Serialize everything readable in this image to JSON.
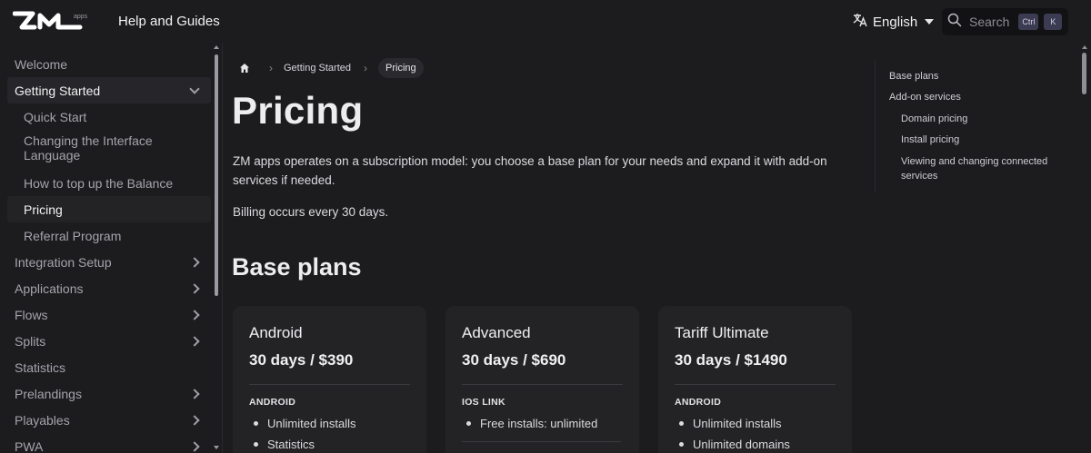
{
  "header": {
    "logo_text": "ZM",
    "logo_sub": "apps",
    "title": "Help and Guides",
    "language": "English",
    "search_placeholder": "Search",
    "kbd_ctrl": "Ctrl",
    "kbd_k": "K"
  },
  "sidebar": {
    "items": [
      {
        "label": "Welcome"
      },
      {
        "label": "Getting Started"
      },
      {
        "label": "Quick Start"
      },
      {
        "label": "Changing the Interface Language"
      },
      {
        "label": "How to top up the Balance"
      },
      {
        "label": "Pricing"
      },
      {
        "label": "Referral Program"
      },
      {
        "label": "Integration Setup"
      },
      {
        "label": "Applications"
      },
      {
        "label": "Flows"
      },
      {
        "label": "Splits"
      },
      {
        "label": "Statistics"
      },
      {
        "label": "Prelandings"
      },
      {
        "label": "Playables"
      },
      {
        "label": "PWA"
      }
    ]
  },
  "breadcrumb": {
    "parent": "Getting Started",
    "current": "Pricing"
  },
  "main": {
    "title": "Pricing",
    "intro": "ZM apps operates on a subscription model: you choose a base plan for your needs and expand it with add-on services if needed.",
    "billing": "Billing occurs every 30 days.",
    "base_plans_heading": "Base plans",
    "plans": [
      {
        "name": "Android",
        "price": "30 days / $390",
        "section": "ANDROID",
        "features": [
          "Unlimited installs",
          "Statistics"
        ]
      },
      {
        "name": "Advanced",
        "price": "30 days / $690",
        "section": "IOS LINK",
        "features": [
          "Free installs: unlimited"
        ]
      },
      {
        "name": "Tariff Ultimate",
        "price": "30 days / $1490",
        "section": "ANDROID",
        "features": [
          "Unlimited installs",
          "Unlimited domains"
        ]
      }
    ]
  },
  "toc": {
    "items": [
      "Base plans",
      "Add-on services",
      "Domain pricing",
      "Install pricing",
      "Viewing and changing connected services"
    ]
  },
  "colors": {
    "background": "#1c1c1f",
    "card": "#232326",
    "text": "#e6e6e8",
    "muted": "#a4a4ab"
  }
}
